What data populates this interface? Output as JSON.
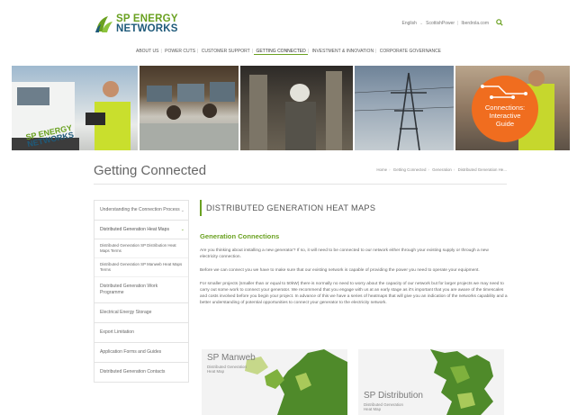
{
  "brand": {
    "line1": "SP ENERGY",
    "line2": "NETWORKS"
  },
  "utility": {
    "language": "English",
    "links": [
      "ScottishPower",
      "Iberdrola.com"
    ]
  },
  "nav": [
    "ABOUT US",
    "POWER CUTS",
    "CUSTOMER SUPPORT",
    "GETTING CONNECTED",
    "INVESTMENT & INNOVATION",
    "CORPORATE GOVERNANCE"
  ],
  "nav_active": "GETTING CONNECTED",
  "banner": {
    "van_logo_line1": "SP ENERGY",
    "van_logo_line2": "NETWORKS",
    "connections_line1": "Connections:",
    "connections_line2": "Interactive",
    "connections_line3": "Guide"
  },
  "page_title": "Getting Connected",
  "breadcrumb": [
    "Home",
    "Getting Connected",
    "Generation",
    "Distributed Generation He..."
  ],
  "sidebar": {
    "items": [
      "Understanding the Connection Process",
      "Distributed Generation Heat Maps",
      "Distributed Generation Work Programme",
      "Electrical Energy Storage",
      "Export Limitation",
      "Application Forms and Guides",
      "Distributed Generation Contacts"
    ],
    "subitems": [
      "Distributed Generation SP Distribution Heat Maps Terms",
      "Distributed Generation SP Manweb Heat Maps Terms"
    ]
  },
  "content": {
    "heading": "DISTRIBUTED GENERATION HEAT MAPS",
    "subheading": "Generation Connections",
    "paragraphs": [
      "Are you thinking about installing a new generator? If so, it will need to be connected to our network either through your existing supply or through a new electricity connection.",
      "Before we can connect you we have to make sure that our existing network is capable of providing the power you need to operate your equipment.",
      "For smaller projects (smaller than or equal to 50kW) there is normally no need to worry about the capacity of our network but for larger projects we may need to carry out some work to connect your generator. We recommend that you engage with us at an early stage as it's important that you are aware of the timescales and costs involved before you begin your project. In advance of this we have a series of heatmaps that will give you an indication of the networks capability and a better understanding of potential opportunities to connect your generator to the electricity network."
    ]
  },
  "maps": [
    {
      "title": "SP Manweb",
      "caption_line1": "Distributed Generation",
      "caption_line2": "Heat Map"
    },
    {
      "title": "SP Distribution",
      "caption_line1": "Distributed Generation",
      "caption_line2": "Heat Map"
    }
  ],
  "colors": {
    "brand_green": "#6aa121",
    "brand_blue": "#1f5a7a",
    "accent_orange": "#f06d1f",
    "map_green": "#4f8a2a"
  }
}
